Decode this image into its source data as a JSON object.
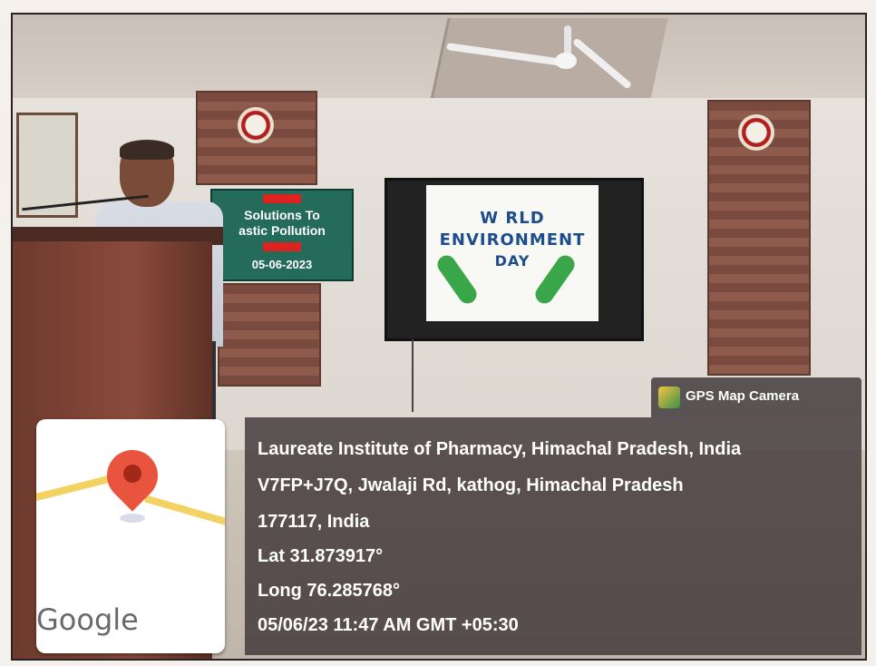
{
  "banner": {
    "tag_top": "",
    "line1": "Solutions To",
    "line2": "astic Pollution",
    "tag_bottom": "",
    "date": "05-06-2023"
  },
  "tv_slide": {
    "line1": "W RLD",
    "line2": "ENVIRONMENT",
    "line3": "DAY"
  },
  "gps_overlay": {
    "app_name": "GPS Map Camera",
    "place": "Laureate Institute of Pharmacy, Himachal Pradesh, India",
    "address_line1": "V7FP+J7Q, Jwalaji Rd, kathog, Himachal Pradesh",
    "address_line2": "177117, India",
    "latitude": "Lat 31.873917°",
    "longitude": "Long 76.285768°",
    "timestamp": "05/06/23 11:47 AM GMT +05:30",
    "map_brand": "Google"
  },
  "colors": {
    "banner_green": "#246b5a",
    "overlay_bg": "#3c3234",
    "pin_red": "#e8543e",
    "road_yellow": "#f3d262"
  }
}
